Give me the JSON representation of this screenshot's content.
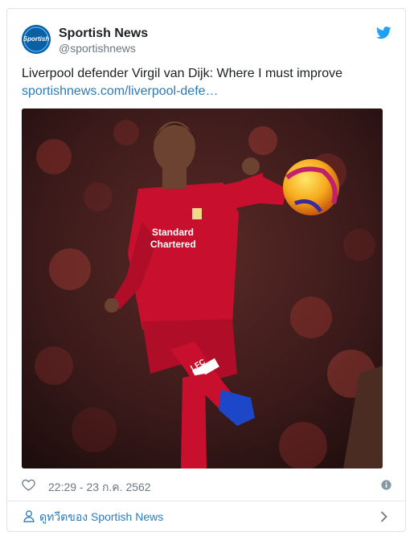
{
  "account": {
    "display_name": "Sportish News",
    "handle": "@sportishnews",
    "avatar_text": "Sportish"
  },
  "tweet": {
    "text": "Liverpool defender Virgil van Dijk: Where I must improve",
    "link": "sportishnews.com/liverpool-defe…",
    "timestamp": "22:29 - 23 ก.ค. 2562"
  },
  "photo": {
    "sponsor_line1": "Standard",
    "sponsor_line2": "Chartered",
    "sock_text": "LFC"
  },
  "footer": {
    "view_tweets_label": "ดูทวีตของ Sportish News"
  },
  "icons": {
    "brand": "twitter-bird-icon",
    "like": "heart-icon",
    "info": "info-icon",
    "profile": "person-icon",
    "chevron": "chevron-right-icon"
  },
  "colors": {
    "link": "#2b7bb9",
    "twitter_blue": "#1da1f2",
    "muted": "#697882",
    "border": "#dfe3e8"
  }
}
